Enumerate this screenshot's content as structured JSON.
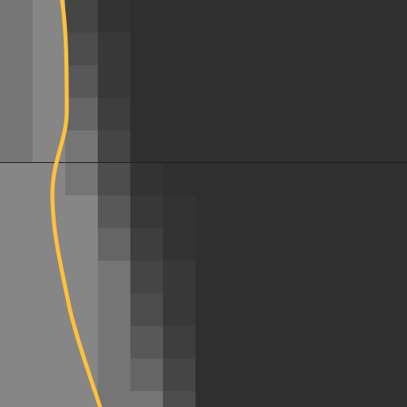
{
  "viewport": {
    "background_color": "#2f2f2f"
  },
  "divider": {
    "color": "#1e1e1e"
  },
  "curve": {
    "color": "#ffc13b"
  },
  "heatmap": {
    "levels_per_column": [
      [
        8,
        8,
        8,
        8,
        8,
        9,
        9,
        9,
        9,
        9,
        9,
        9,
        9
      ],
      [
        9,
        9,
        9,
        9,
        9,
        9,
        9,
        9,
        9,
        9,
        9,
        9,
        9
      ],
      [
        4,
        5,
        6,
        7,
        8,
        8,
        9,
        9,
        9,
        9,
        9,
        9,
        9
      ],
      [
        1,
        2,
        2,
        3,
        4,
        5,
        6,
        7,
        8,
        8,
        8,
        8,
        8
      ],
      [
        0,
        0,
        0,
        0,
        0,
        1,
        2,
        3,
        4,
        5,
        6,
        7,
        8
      ],
      [
        0,
        0,
        0,
        0,
        0,
        0,
        1,
        1,
        2,
        2,
        3,
        4,
        5
      ]
    ]
  }
}
